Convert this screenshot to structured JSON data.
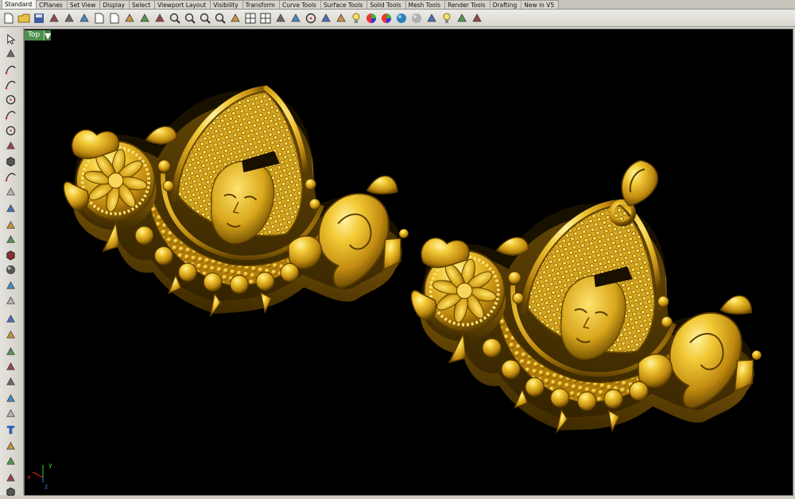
{
  "tabs": [
    "Standard",
    "CPlanes",
    "Set View",
    "Display",
    "Select",
    "Viewport Layout",
    "Visibility",
    "Transform",
    "Curve Tools",
    "Surface Tools",
    "Solid Tools",
    "Mesh Tools",
    "Render Tools",
    "Drafting",
    "New in V5"
  ],
  "active_tab": "Standard",
  "viewport": {
    "name": "Top",
    "dropdown_glyph": "▾"
  },
  "axis": {
    "x": "x",
    "y": "y",
    "z": "z"
  },
  "toolbar_icons": [
    "new-file-icon",
    "open-icon",
    "save-icon",
    "print-icon",
    "import-icon",
    "cut-icon",
    "copy-icon",
    "paste-icon",
    "undo-icon",
    "pan-icon",
    "rotate-icon",
    "zoom-icon",
    "zoom-window-icon",
    "zoom-extents-icon",
    "zoom-selected-icon",
    "undo-view-icon",
    "four-view-icon",
    "grid-icon",
    "select-car-icon",
    "select-icon",
    "circle-icon",
    "lock-icon",
    "hide-icon",
    "light-icon",
    "color-icon",
    "material-icon",
    "render-sphere-icon",
    "shaded-sphere-icon",
    "render-icon",
    "spotlight-icon",
    "options-icon",
    "cplane-icon"
  ],
  "left_icons": [
    "pointer-icon",
    "point-icon",
    "polyline-icon",
    "curve-icon",
    "circle-tool-icon",
    "arc-icon",
    "ellipse-icon",
    "polygon-icon",
    "rectangle-icon",
    "free-curve-icon",
    "fillet-icon",
    "surface-icon",
    "extrude-icon",
    "revolve-icon",
    "box-icon",
    "sphere-icon",
    "cylinder-icon",
    "mesh-icon",
    "gumball-icon",
    "move-icon",
    "boolean-icon",
    "split-icon",
    "join-icon",
    "explode-icon",
    "trim-icon",
    "text-icon",
    "array-icon",
    "group-icon",
    "layer-icon",
    "solid-box-icon",
    "more-icon"
  ],
  "colors": {
    "viewport_bg": "#000000",
    "gold_light": "#f6d24a",
    "gold_mid": "#c99412",
    "gold_dark": "#5a3d00",
    "label_bg": "#4e8f4e"
  }
}
